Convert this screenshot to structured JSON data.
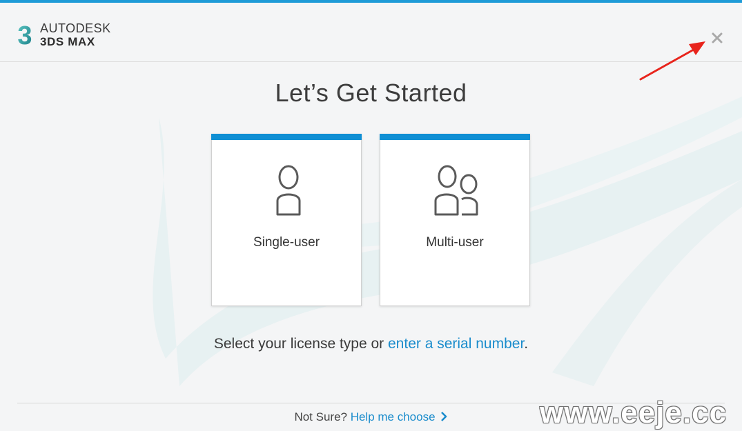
{
  "app": {
    "brand": "AUTODESK",
    "product": "3DS MAX",
    "logo_glyph": "3"
  },
  "colors": {
    "accent": "#1e9bd7",
    "card_bar": "#0f8fd4",
    "link": "#1a8ccc",
    "arrow": "#e8241c"
  },
  "icons": {
    "close": "close-icon",
    "single": "single-user-icon",
    "multi": "multi-user-icon",
    "chevron": "chevron-right-icon"
  },
  "main": {
    "title": "Let’s Get Started",
    "cards": [
      {
        "label": "Single-user"
      },
      {
        "label": "Multi-user"
      }
    ],
    "select_text": "Select your license type or ",
    "serial_link": "enter a serial number",
    "select_end": "."
  },
  "footer": {
    "not_sure": "Not Sure? ",
    "help_link": "Help me choose"
  },
  "watermark": "www.eeje.cc"
}
